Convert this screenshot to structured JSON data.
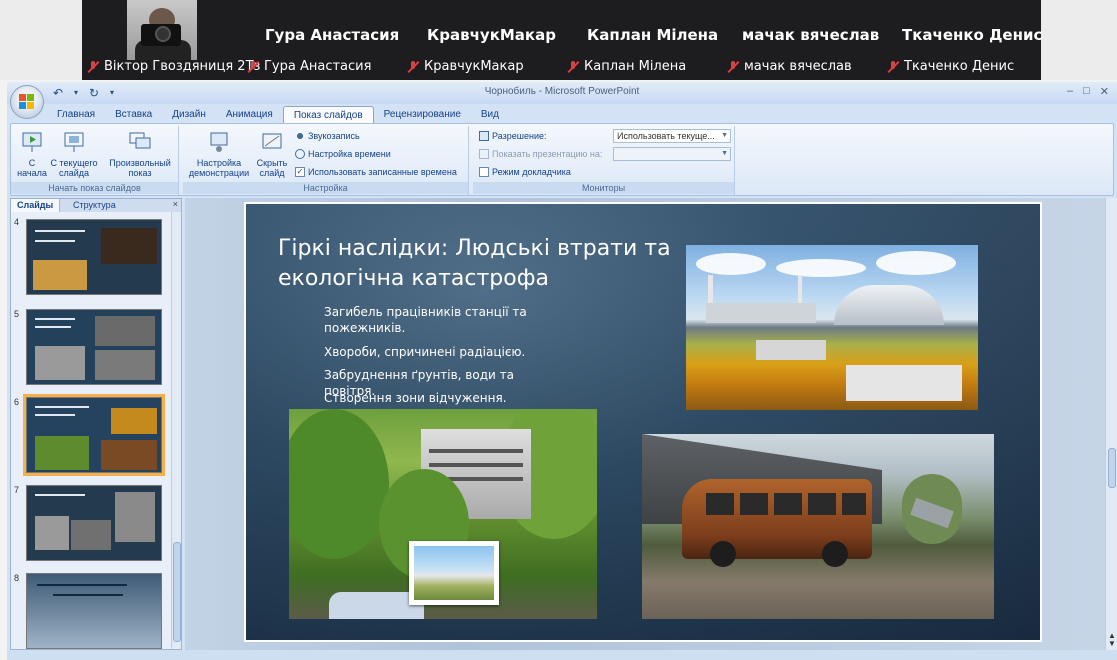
{
  "conference": {
    "tile_names": [
      "Гура Анастасия",
      "КравчукМакар",
      "Каплан Мілена",
      "мачак вячеслав",
      "Ткаченко Денис"
    ],
    "muted_labels": [
      "Віктор Гвоздяниця 2Тз",
      "Гура Анастасия",
      "КравчукМакар",
      "Каплан Мілена",
      "мачак вячеслав",
      "Ткаченко Денис"
    ]
  },
  "window": {
    "title": "Чорнобиль - Microsoft PowerPoint"
  },
  "ribbon": {
    "tabs": [
      "Главная",
      "Вставка",
      "Дизайн",
      "Анимация",
      "Показ слайдов",
      "Рецензирование",
      "Вид"
    ],
    "active_tab": "Показ слайдов",
    "group_start": {
      "label": "Начать показ слайдов",
      "from_start": "С начала",
      "from_current": "С текущего слайда",
      "custom": "Произвольный показ"
    },
    "group_setup": {
      "label": "Настройка",
      "setup_show": "Настройка демонстрации",
      "hide_slide": "Скрыть слайд",
      "record_narration": "Звукозапись",
      "rehearse": "Настройка времени",
      "use_timings": "Использовать записанные времена"
    },
    "group_monitors": {
      "label": "Мониторы",
      "resolution_label": "Разрешение:",
      "resolution_value": "Использовать текуще...",
      "show_on_label": "Показать презентацию на:",
      "presenter_view": "Режим докладчика"
    }
  },
  "slides_panel": {
    "tab_slides": "Слайды",
    "tab_outline": "Структура",
    "close": "×",
    "thumbs": [
      {
        "num": "4"
      },
      {
        "num": "5"
      },
      {
        "num": "6"
      },
      {
        "num": "7"
      },
      {
        "num": "8"
      }
    ]
  },
  "slide": {
    "title": "Гіркі наслідки: Людські втрати та екологічна катастрофа",
    "bullets": [
      "Загибель працівників станції та пожежників.",
      "Хвороби, спричинені радіацією.",
      "Забруднення ґрунтів, води та повітря.",
      "Створення зони відчуження."
    ]
  },
  "colors": {
    "conference_bg": "#1d1d1f",
    "ribbon_text": "#15428b",
    "selected_thumb": "#f6b04a",
    "slide_bg": "#2b4a66"
  }
}
